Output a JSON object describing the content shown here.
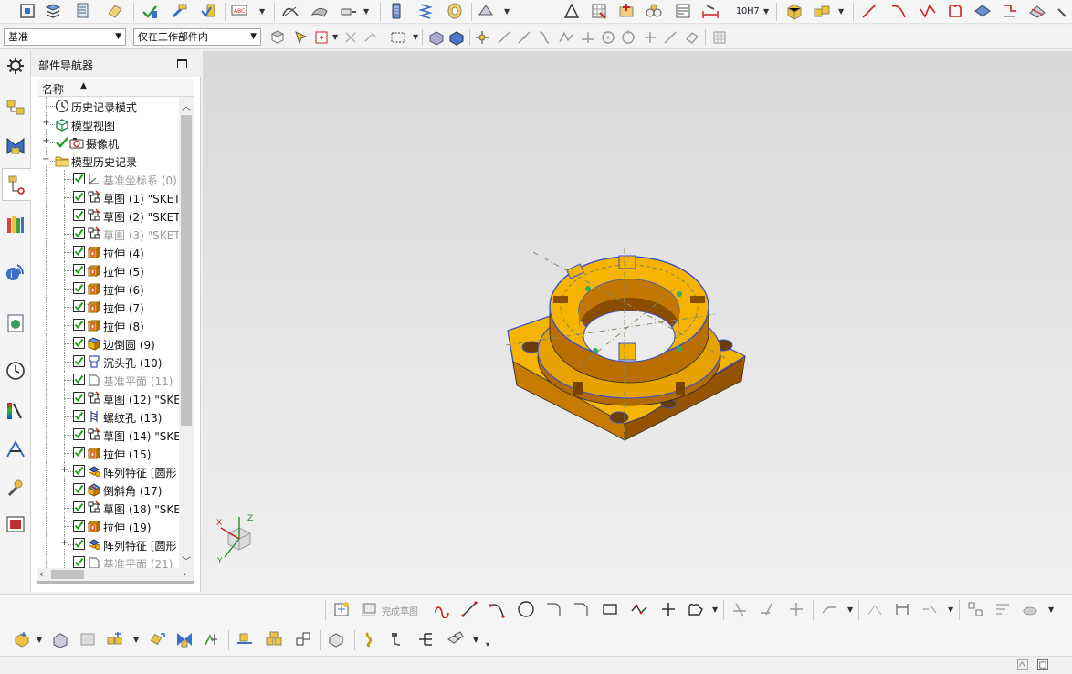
{
  "toolbar_top": {
    "tolerance_label": "10H7",
    "icons": [
      "align-icon",
      "layers-icon",
      "stack-icon",
      "note-icon",
      "check-arrow-icon",
      "hammer-icon",
      "mark-icon",
      "abc-icon",
      "curve-surface-icon",
      "sheet-icon",
      "measure-icon",
      "battery-icon",
      "spring-icon",
      "coil-icon",
      "settings-icon",
      "triangle-icon",
      "grid-icon",
      "star-icon",
      "gear-group-icon",
      "report-icon",
      "dimension-icon",
      "tolerance-icon",
      "cube-icon",
      "cube-stack-icon",
      "line-icon",
      "arc-icon",
      "polyline-icon",
      "shape-icon",
      "shade-icon",
      "curve-icon",
      "surface-icon"
    ]
  },
  "selection_bar": {
    "filter_value": "基准",
    "scope_value": "仅在工作部件内"
  },
  "resource_bar": {
    "items": [
      "settings-icon",
      "assembly-navigator-icon",
      "constraint-navigator-icon",
      "part-navigator-icon",
      "reuse-library-icon",
      "web-browser-icon",
      "history-icon",
      "system-materials-icon",
      "process-studio-icon",
      "manufacturing-wizard-icon",
      "roles-icon"
    ]
  },
  "navigator": {
    "title": "部件导航器",
    "column_header": "名称",
    "sort_indicator": "▲",
    "rows": [
      {
        "label": "历史记录模式",
        "icon": "clock-icon",
        "level": 0,
        "expand": "",
        "check": false,
        "dim": false
      },
      {
        "label": "模型视图",
        "icon": "model-view-icon",
        "level": 0,
        "expand": "+",
        "check": false,
        "dim": false
      },
      {
        "label": "摄像机",
        "icon": "camera-icon",
        "level": 0,
        "expand": "+",
        "check": true,
        "dim": false
      },
      {
        "label": "模型历史记录",
        "icon": "folder-icon",
        "level": 0,
        "expand": "-",
        "check": false,
        "dim": false
      },
      {
        "label": "基准坐标系 (0)",
        "icon": "csys-icon",
        "level": 1,
        "expand": "",
        "check": true,
        "dim": true
      },
      {
        "label": "草图 (1) \"SKET",
        "icon": "sketch-icon",
        "level": 1,
        "expand": "",
        "check": true,
        "dim": false
      },
      {
        "label": "草图 (2) \"SKET",
        "icon": "sketch-icon",
        "level": 1,
        "expand": "",
        "check": true,
        "dim": false
      },
      {
        "label": "草图 (3) \"SKET",
        "icon": "sketch-icon",
        "level": 1,
        "expand": "",
        "check": true,
        "dim": true
      },
      {
        "label": "拉伸 (4)",
        "icon": "extrude-icon",
        "level": 1,
        "expand": "",
        "check": true,
        "dim": false
      },
      {
        "label": "拉伸 (5)",
        "icon": "extrude-icon",
        "level": 1,
        "expand": "",
        "check": true,
        "dim": false
      },
      {
        "label": "拉伸 (6)",
        "icon": "extrude-icon",
        "level": 1,
        "expand": "",
        "check": true,
        "dim": false
      },
      {
        "label": "拉伸 (7)",
        "icon": "extrude-icon",
        "level": 1,
        "expand": "",
        "check": true,
        "dim": false
      },
      {
        "label": "拉伸 (8)",
        "icon": "extrude-icon",
        "level": 1,
        "expand": "",
        "check": true,
        "dim": false
      },
      {
        "label": "边倒圆 (9)",
        "icon": "edge-blend-icon",
        "level": 1,
        "expand": "",
        "check": true,
        "dim": false
      },
      {
        "label": "沉头孔 (10)",
        "icon": "counterbore-hole-icon",
        "level": 1,
        "expand": "",
        "check": true,
        "dim": false
      },
      {
        "label": "基准平面 (11)",
        "icon": "datum-plane-icon",
        "level": 1,
        "expand": "",
        "check": true,
        "dim": true
      },
      {
        "label": "草图 (12) \"SKE",
        "icon": "sketch-icon",
        "level": 1,
        "expand": "",
        "check": true,
        "dim": false
      },
      {
        "label": "螺纹孔 (13)",
        "icon": "threaded-hole-icon",
        "level": 1,
        "expand": "",
        "check": true,
        "dim": false
      },
      {
        "label": "草图 (14) \"SKE",
        "icon": "sketch-icon",
        "level": 1,
        "expand": "",
        "check": true,
        "dim": false
      },
      {
        "label": "拉伸 (15)",
        "icon": "extrude-icon",
        "level": 1,
        "expand": "",
        "check": true,
        "dim": false
      },
      {
        "label": "阵列特征 [圆形",
        "icon": "pattern-icon",
        "level": 1,
        "expand": "+",
        "check": true,
        "dim": false
      },
      {
        "label": "倒斜角 (17)",
        "icon": "chamfer-icon",
        "level": 1,
        "expand": "",
        "check": true,
        "dim": false
      },
      {
        "label": "草图 (18) \"SKE",
        "icon": "sketch-icon",
        "level": 1,
        "expand": "",
        "check": true,
        "dim": false
      },
      {
        "label": "拉伸 (19)",
        "icon": "extrude-icon",
        "level": 1,
        "expand": "",
        "check": true,
        "dim": false
      },
      {
        "label": "阵列特征 [圆形",
        "icon": "pattern-icon",
        "level": 1,
        "expand": "+",
        "check": true,
        "dim": false
      },
      {
        "label": "基准平面 (21)",
        "icon": "datum-plane-icon",
        "level": 1,
        "expand": "",
        "check": true,
        "dim": true
      }
    ]
  },
  "viewport": {
    "triad_axes": {
      "x": "X",
      "y": "Y",
      "z": "Z"
    },
    "model_colors": {
      "body": "#f5b400",
      "shade": "#b86e00",
      "edge": "#3a52c8"
    }
  },
  "sketch_toolbar": {
    "finish_label": "完成草图"
  },
  "colors": {
    "accent": "#3a52c8",
    "check": "#1aa01a",
    "dim_text": "#9a9a9a"
  }
}
